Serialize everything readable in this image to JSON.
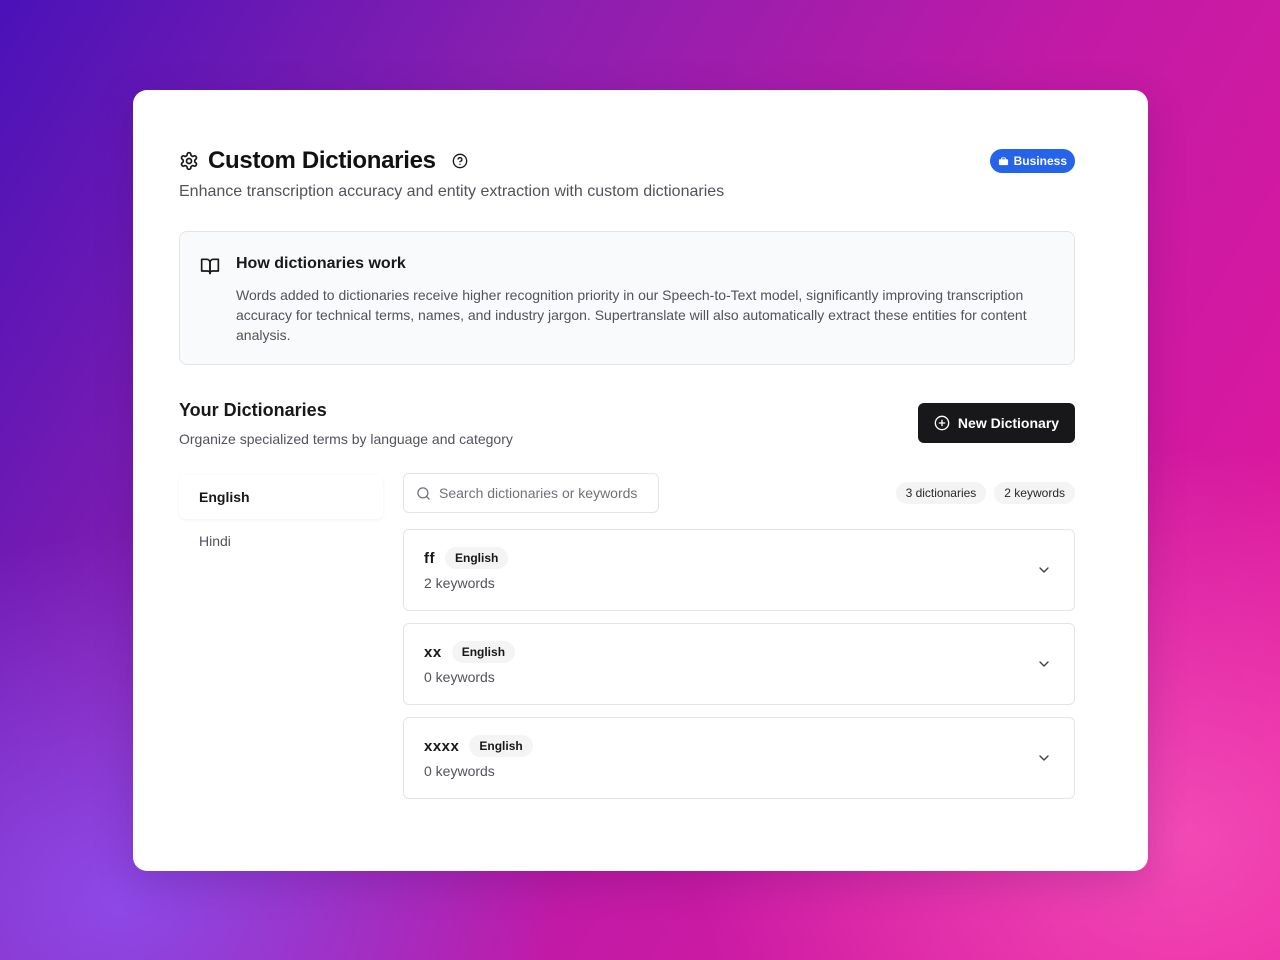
{
  "header": {
    "title": "Custom Dictionaries",
    "subtitle": "Enhance transcription accuracy and entity extraction with custom dictionaries",
    "plan_badge": "Business"
  },
  "info": {
    "title": "How dictionaries work",
    "body": "Words added to dictionaries receive higher recognition priority in our Speech-to-Text model, significantly improving transcription accuracy for technical terms, names, and industry jargon. Supertranslate will also automatically extract these entities for content analysis."
  },
  "section": {
    "title": "Your Dictionaries",
    "subtitle": "Organize specialized terms by language and category",
    "new_button_label": "New Dictionary"
  },
  "language_tabs": [
    {
      "label": "English",
      "active": true
    },
    {
      "label": "Hindi",
      "active": false
    }
  ],
  "search": {
    "placeholder": "Search dictionaries or keywords",
    "value": ""
  },
  "counts": {
    "dictionaries": "3 dictionaries",
    "keywords": "2 keywords"
  },
  "dictionaries": [
    {
      "name": "ff",
      "language": "English",
      "keywords": "2 keywords"
    },
    {
      "name": "xx",
      "language": "English",
      "keywords": "0 keywords"
    },
    {
      "name": "xxxx",
      "language": "English",
      "keywords": "0 keywords"
    }
  ],
  "colors": {
    "badge": "#2563eb",
    "primary_button": "#18181b"
  }
}
